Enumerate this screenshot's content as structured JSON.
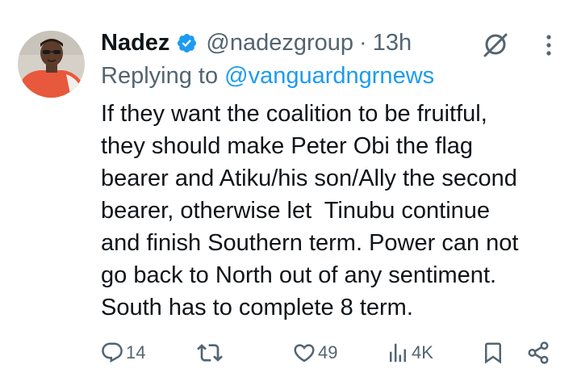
{
  "tweet": {
    "author_name": "Nadez",
    "handle": "@nadezgroup",
    "separator": "·",
    "time": "13h",
    "reply_prefix": "Replying to",
    "reply_handle": "@vanguardngrnews",
    "body_lines": [
      "If they want the coalition to be fruitful,",
      "they should make Peter Obi the flag",
      "bearer and Atiku/his son/Ally the second",
      "bearer, otherwise let  Tinubu continue",
      "and finish Southern term. Power can not",
      "go back to North out of any sentiment.",
      "South has to complete 8 term."
    ]
  },
  "actions": {
    "replies": "14",
    "retweets": "",
    "likes": "49",
    "views": "4K"
  },
  "icons": {
    "verified": "verified-badge-icon",
    "grok": "grok-icon",
    "more": "more-vertical-icon",
    "reply": "reply-icon",
    "retweet": "retweet-icon",
    "like": "heart-icon",
    "views": "views-icon",
    "bookmark": "bookmark-icon",
    "share": "share-icon"
  },
  "colors": {
    "text": "#0f1419",
    "secondary": "#536471",
    "link": "#1d9bf0",
    "verified": "#1d9bf0"
  }
}
